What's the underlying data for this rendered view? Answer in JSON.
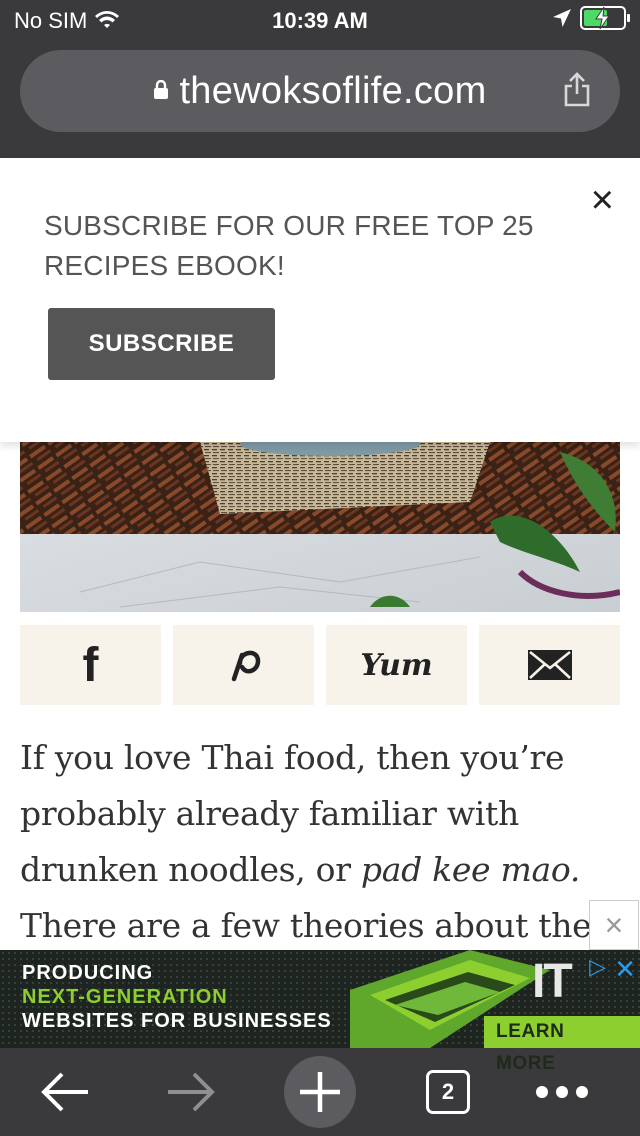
{
  "status": {
    "carrier": "No SIM",
    "time": "10:39 AM",
    "battery_level": 0.6
  },
  "browser": {
    "url": "thewoksoflife.com"
  },
  "popup": {
    "message": "SUBSCRIBE FOR OUR FREE TOP 25 RECIPES EBOOK!",
    "button_label": "SUBSCRIBE",
    "close_label": "×"
  },
  "share": {
    "yum_label": "Yum"
  },
  "article": {
    "text_before": "If you love Thai food, then you’re probably already familiar with drunken noodles, or ",
    "text_italic": "pad kee mao.",
    "text_after": " There are a few theories about the"
  },
  "ad": {
    "close_label": "×",
    "line1": "PRODUCING",
    "line2": "NEXT-GENERATION",
    "line3": "WEBSITES FOR BUSINESSES",
    "cta": "LEARN MORE",
    "logo": "IT",
    "adchoices_x": "✕",
    "line1_color": "#ffffff",
    "line2_color": "#8ccf2f",
    "line3_color": "#ffffff"
  },
  "toolbar": {
    "tab_count": "2"
  }
}
